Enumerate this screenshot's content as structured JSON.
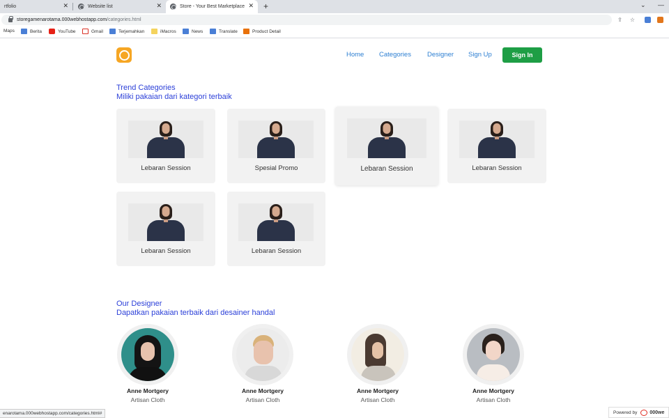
{
  "browser": {
    "tabs": [
      {
        "title": "rtfolio"
      },
      {
        "title": "Website list"
      },
      {
        "title": "Store - Your Best Marketplace"
      }
    ],
    "url_host": "storegamenarotama.000webhostapp.com",
    "url_path": "/categories.html",
    "bookmarks": [
      "Maps",
      "Berita",
      "YouTube",
      "Gmail",
      "Terjemahkan",
      "iMacros",
      "News",
      "Translate",
      "Product Detail"
    ],
    "status_url": "enarotama.000webhostapp.com/categories.html#"
  },
  "nav": {
    "items": [
      "Home",
      "Categories",
      "Designer",
      "Sign Up"
    ],
    "signin": "Sign In"
  },
  "trend": {
    "title": "Trend Categories",
    "subtitle": "Miliki pakaian dari kategori terbaik",
    "cards": [
      {
        "label": "Lebaran Session"
      },
      {
        "label": "Spesial Promo"
      },
      {
        "label": "Lebaran Session"
      },
      {
        "label": "Lebaran Session"
      },
      {
        "label": "Lebaran Session"
      },
      {
        "label": "Lebaran Session"
      }
    ]
  },
  "designer": {
    "title": "Our Designer",
    "subtitle": "Dapatkan pakaian terbaik dari desainer handal",
    "people": [
      {
        "name": "Anne Mortgery",
        "role": "Artisan Cloth"
      },
      {
        "name": "Anne Mortgery",
        "role": "Artisan Cloth"
      },
      {
        "name": "Anne Mortgery",
        "role": "Artisan Cloth"
      },
      {
        "name": "Anne Mortgery",
        "role": "Artisan Cloth"
      }
    ]
  },
  "footer": {
    "powered_label": "Powered by",
    "powered_brand": "000we"
  },
  "colors": {
    "accent_blue": "#2b3fd8",
    "nav_blue": "#2d7fd2",
    "signin_green": "#1e9e45",
    "logo_orange": "#f6a623"
  }
}
